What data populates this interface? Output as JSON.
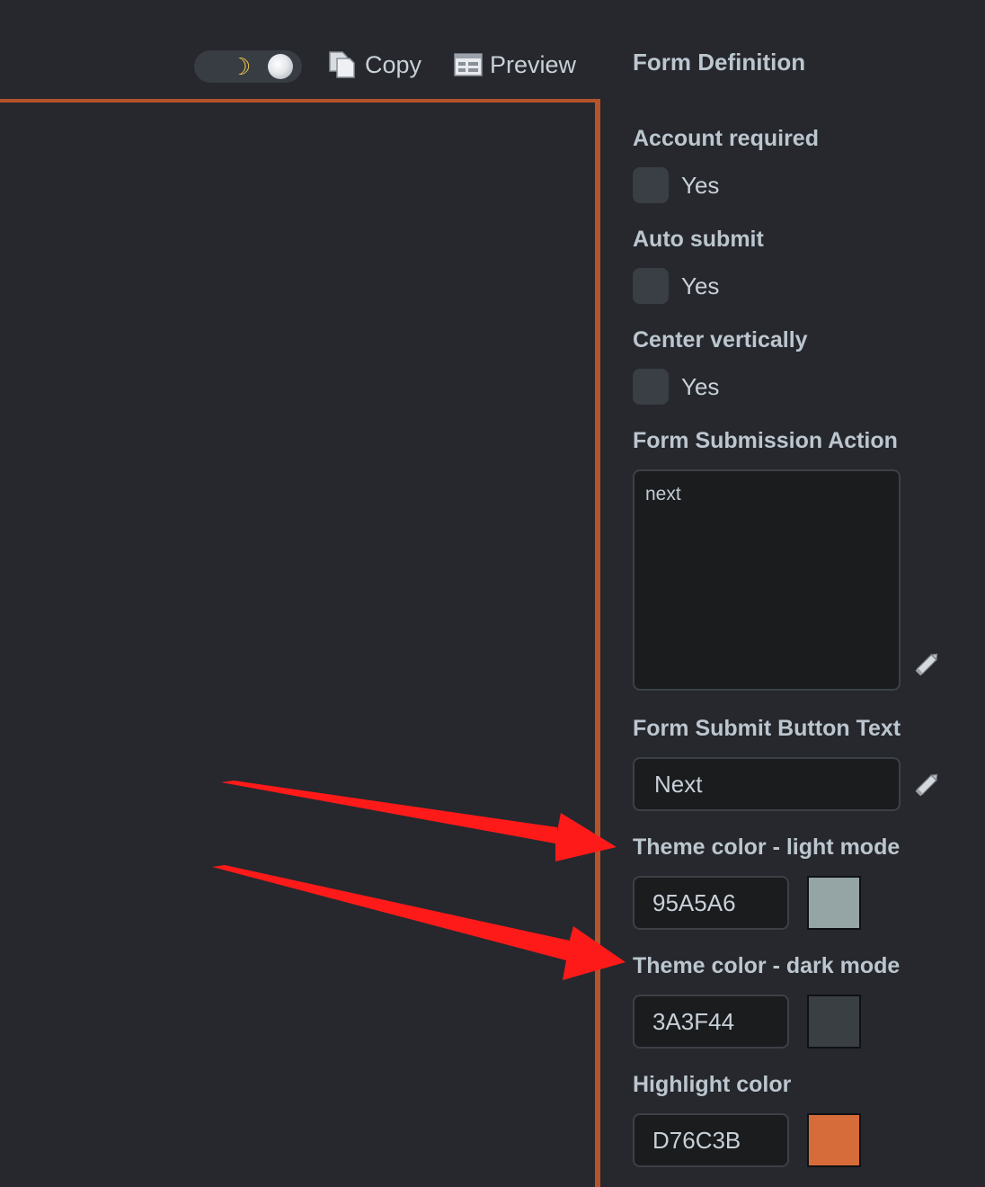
{
  "toolbar": {
    "theme_toggle": {
      "moon_icon": "moon-icon",
      "sun_icon": "sun-icon",
      "mode": "dark"
    },
    "copy_label": "Copy",
    "preview_label": "Preview"
  },
  "panel": {
    "title": "Form Definition",
    "account_required": {
      "label": "Account required",
      "option": "Yes",
      "checked": false
    },
    "auto_submit": {
      "label": "Auto submit",
      "option": "Yes",
      "checked": false
    },
    "center_vertically": {
      "label": "Center vertically",
      "option": "Yes",
      "checked": false
    },
    "submission_action": {
      "label": "Form Submission Action",
      "value": "next"
    },
    "submit_button_text": {
      "label": "Form Submit Button Text",
      "value": "Next"
    },
    "theme_light": {
      "label": "Theme color - light mode",
      "value": "95A5A6",
      "color": "#95A5A6"
    },
    "theme_dark": {
      "label": "Theme color - dark mode",
      "value": "3A3F44",
      "color": "#3A3F44"
    },
    "highlight": {
      "label": "Highlight color",
      "value": "D76C3B",
      "color": "#D76C3B"
    }
  },
  "colors": {
    "background": "#26282d",
    "canvas_border": "#b5532a",
    "annotation_arrow": "#ff1a1a"
  }
}
